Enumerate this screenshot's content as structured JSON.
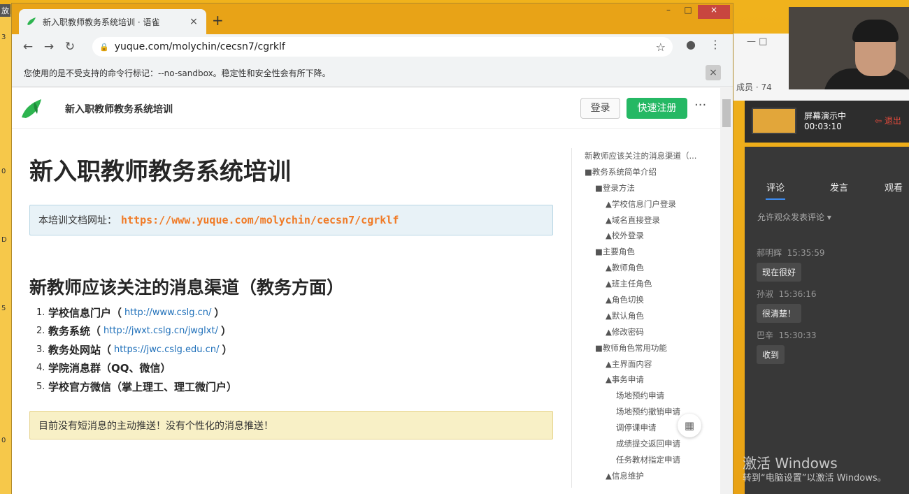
{
  "desktop": {
    "label": "放",
    "strip_marks": [
      "3",
      "0",
      "D",
      "5",
      "0"
    ]
  },
  "browser": {
    "tab_title": "新入职教师教务系统培训 · 语雀",
    "tab_close": "×",
    "new_tab": "+",
    "window_buttons": {
      "minimize": "–",
      "maximize": "□",
      "close": "×"
    },
    "nav": {
      "back": "←",
      "forward": "→",
      "reload": "↻"
    },
    "url": "yuque.com/molychin/cecsn7/cgrklf",
    "lock_icon": "🔒",
    "right_icons": {
      "star": "☆",
      "account": "●",
      "menu": "⋮"
    },
    "infobar_text": "您使用的是不受支持的命令行标记：--no-sandbox。稳定性和安全性会有所下降。",
    "infobar_close": "×"
  },
  "page": {
    "site_title": "新入职教师教务系统培训",
    "login_label": "登录",
    "register_label": "快速注册",
    "more_label": "···",
    "h1": "新入职教师教务系统培训",
    "doc_url_label": "本培训文档网址：",
    "doc_url": "https://www.yuque.com/molychin/cecsn7/cgrklf",
    "h2": "新教师应该关注的消息渠道（教务方面）",
    "list": [
      {
        "num": "1.",
        "text": "学校信息门户（",
        "link": "http://www.cslg.cn/",
        "end": "）"
      },
      {
        "num": "2.",
        "text": "教务系统（",
        "link": "http://jwxt.cslg.cn/jwglxt/",
        "end": "）"
      },
      {
        "num": "3.",
        "text": "教务处网站（",
        "link": "https://jwc.cslg.edu.cn/",
        "end": "）"
      },
      {
        "num": "4.",
        "text": "学院消息群（QQ、微信）",
        "link": "",
        "end": ""
      },
      {
        "num": "5.",
        "text": "学校官方微信（掌上理工、理工微门户）",
        "link": "",
        "end": ""
      }
    ],
    "notice": "目前没有短消息的主动推送！没有个性化的消息推送！",
    "toc": [
      {
        "t": "新教师应该关注的消息渠道（...",
        "level": 0
      },
      {
        "t": "■教务系统简单介绍",
        "level": 0
      },
      {
        "t": "■登录方法",
        "level": 1
      },
      {
        "t": "▲学校信息门户登录",
        "level": 2
      },
      {
        "t": "▲域名直接登录",
        "level": 2
      },
      {
        "t": "▲校外登录",
        "level": 2
      },
      {
        "t": "■主要角色",
        "level": 1
      },
      {
        "t": "▲教师角色",
        "level": 2
      },
      {
        "t": "▲班主任角色",
        "level": 2
      },
      {
        "t": "▲角色切换",
        "level": 2
      },
      {
        "t": "▲默认角色",
        "level": 2
      },
      {
        "t": "▲修改密码",
        "level": 2
      },
      {
        "t": "■教师角色常用功能",
        "level": 1
      },
      {
        "t": "▲主界面内容",
        "level": 2
      },
      {
        "t": "▲事务申请",
        "level": 2
      },
      {
        "t": "场地预约申请",
        "level": 3
      },
      {
        "t": "场地预约撤销申请",
        "level": 3
      },
      {
        "t": "调停课申请",
        "level": 3
      },
      {
        "t": "成绩提交返回申请",
        "level": 3
      },
      {
        "t": "任务教材指定申请",
        "level": 3
      },
      {
        "t": "▲信息维护",
        "level": 2
      }
    ],
    "qr_icon": "▦"
  },
  "meeting": {
    "window_controls": "—   □",
    "members": "成员 · 74",
    "live_title": "屏幕演示中",
    "live_time": "00:03:10",
    "exit_label": "⇦ 退出",
    "tabs": [
      "评论",
      "发言",
      "观看"
    ],
    "permission": "允许观众发表评论 ▾",
    "messages": [
      {
        "user": "郝明辉",
        "time": "15:35:59",
        "text": "现在很好"
      },
      {
        "user": "孙淑",
        "time": "15:36:16",
        "text": "很清楚！"
      },
      {
        "user": "巴辛",
        "time": "15:30:33",
        "text": "收到"
      }
    ]
  },
  "watermark": {
    "line1": "激活 Windows",
    "line2": "转到“电脑设置”以激活 Windows。"
  }
}
